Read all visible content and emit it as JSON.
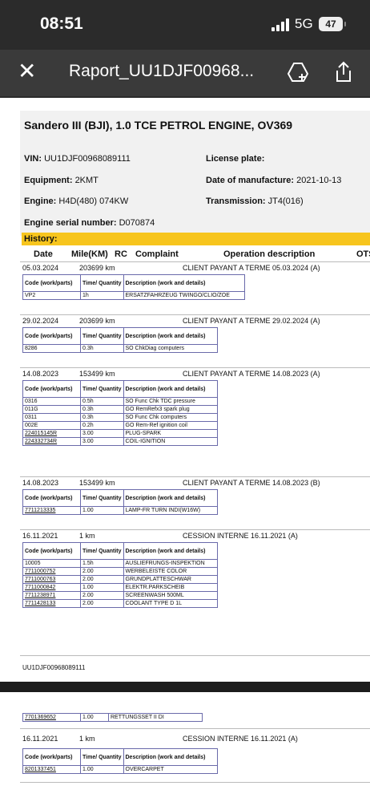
{
  "status": {
    "time": "08:51",
    "network": "5G",
    "battery": "47"
  },
  "app": {
    "title": "Raport_UU1DJF00968..."
  },
  "vehicle": {
    "title": "Sandero III (BJI), 1.0 TCE PETROL ENGINE, OV369",
    "vin_label": "VIN:",
    "vin": "UU1DJF00968089111",
    "plate_label": "License plate:",
    "plate": "",
    "equip_label": "Equipment:",
    "equip": "2KMT",
    "mfg_label": "Date of manufacture:",
    "mfg": "2021-10-13",
    "engine_label": "Engine:",
    "engine": "H4D(480) 074KW",
    "trans_label": "Transmission:",
    "trans": "JT4(016)",
    "serial_label": "Engine serial number:",
    "serial": "D070874"
  },
  "history": {
    "label": "History:",
    "columns": [
      "Date",
      "Mile(KM)",
      "RC",
      "Complaint",
      "Operation description",
      "OTS"
    ],
    "parts_headers": [
      "Code (work/parts)",
      "Time/ Quantity",
      "Description (work and details)"
    ],
    "entries": [
      {
        "date": "05.03.2024",
        "km": "203699 km",
        "op": "CLIENT PAYANT A TERME 05.03.2024 (A)",
        "rows": [
          [
            "VP2",
            "1h",
            "ERSATZFAHRZEUG TWINGO/CLIO/ZOE"
          ]
        ]
      },
      {
        "date": "29.02.2024",
        "km": "203699 km",
        "op": "CLIENT PAYANT A TERME 29.02.2024 (A)",
        "rows": [
          [
            "8286",
            "0.3h",
            "SO ChkDiag computers"
          ]
        ]
      },
      {
        "date": "14.08.2023",
        "km": "153499 km",
        "op": "CLIENT PAYANT A TERME 14.08.2023 (A)",
        "rows": [
          [
            "0316",
            "0.5h",
            "SO Func Chk TDC pressure"
          ],
          [
            "011G",
            "0.3h",
            "GO RemRefx3 spark plug"
          ],
          [
            "0311",
            "0.3h",
            "SO Func Chk computers"
          ],
          [
            "002E",
            "0.2h",
            "GO Rem-Ref ignition coil"
          ],
          [
            "224015145R",
            "3.00",
            "PLUG-SPARK"
          ],
          [
            "224332734R",
            "3.00",
            "COIL-IGNITION"
          ]
        ]
      },
      {
        "date": "14.08.2023",
        "km": "153499 km",
        "op": "CLIENT PAYANT A TERME 14.08.2023 (B)",
        "rows": [
          [
            "7711213335",
            "1.00",
            "LAMP-FR TURN INDI(W16W)"
          ]
        ]
      },
      {
        "date": "16.11.2021",
        "km": "1 km",
        "op": "CESSION INTERNE 16.11.2021 (A)",
        "rows": [
          [
            "10005",
            "1.5h",
            "AUSLIEFRUNGS-INSPEKTION"
          ],
          [
            "7711000752",
            "2.00",
            "WERBELEISTE COLOR"
          ],
          [
            "7711000763",
            "2.00",
            "GRUNDPLATTESCHWAR"
          ],
          [
            "7711000842",
            "1.00",
            "ELEKTR.PARKSCHEIB"
          ],
          [
            "7711238971",
            "2.00",
            "SCREENWASH 500ML"
          ],
          [
            "7711428133",
            "2.00",
            "COOLANT TYPE D 1L"
          ]
        ]
      }
    ],
    "footer_id": "UU1DJF00968089111",
    "page2_row": [
      "7701369652",
      "1.00",
      "RETTUNGSSET II DI"
    ],
    "page2_entry": {
      "date": "16.11.2021",
      "km": "1 km",
      "op": "CESSION INTERNE 16.11.2021 (A)",
      "rows": [
        [
          "8201337451",
          "1.00",
          "OVERCARPET"
        ]
      ]
    }
  },
  "colors": {
    "yellow": "#f7c51e",
    "dark": "#2b2b2b",
    "table_border": "#6a6aaa"
  }
}
